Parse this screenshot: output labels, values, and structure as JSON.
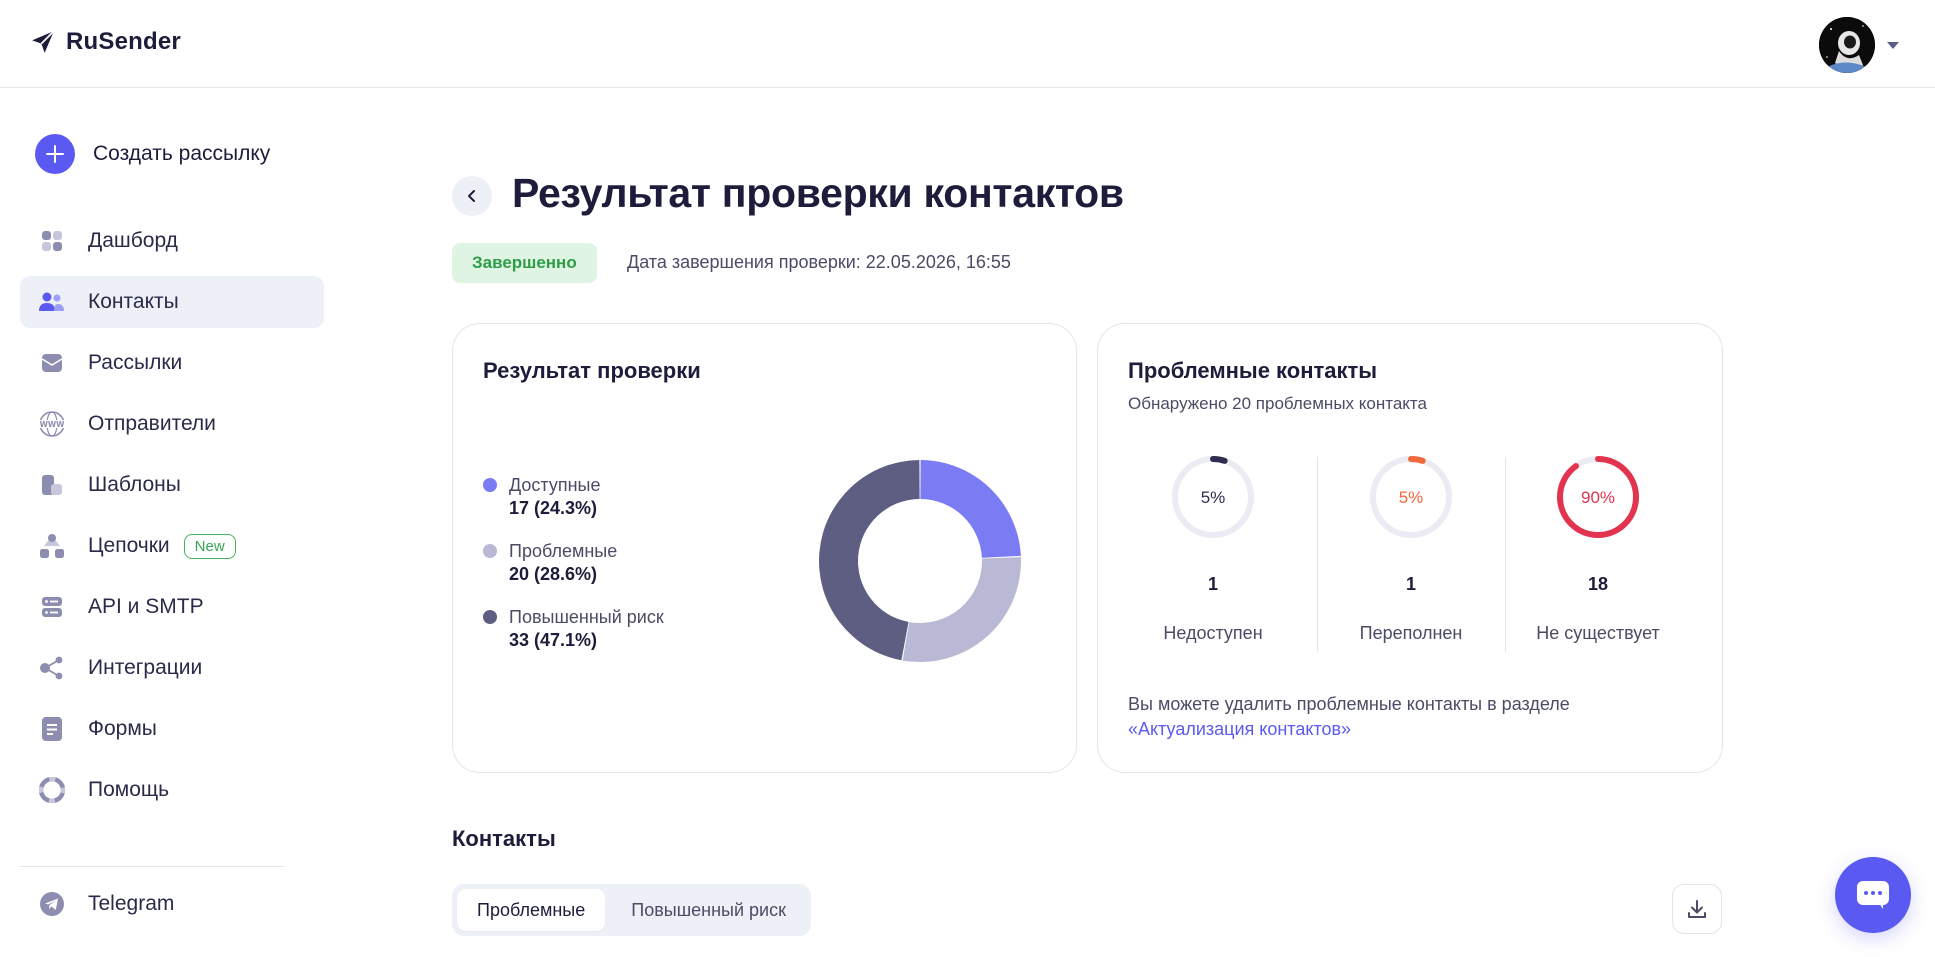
{
  "app": {
    "name": "RuSender"
  },
  "sidebar": {
    "create_label": "Создать рассылку",
    "items": [
      {
        "label": "Дашборд",
        "icon": "dashboard-icon"
      },
      {
        "label": "Контакты",
        "icon": "contacts-icon",
        "active": true
      },
      {
        "label": "Рассылки",
        "icon": "mailings-icon"
      },
      {
        "label": "Отправители",
        "icon": "www-icon"
      },
      {
        "label": "Шаблоны",
        "icon": "templates-icon"
      },
      {
        "label": "Цепочки",
        "icon": "chains-icon",
        "badge": "New"
      },
      {
        "label": "API и SMTP",
        "icon": "server-icon"
      },
      {
        "label": "Интеграции",
        "icon": "integrations-icon"
      },
      {
        "label": "Формы",
        "icon": "forms-icon"
      },
      {
        "label": "Помощь",
        "icon": "help-icon"
      }
    ],
    "telegram_label": "Telegram"
  },
  "page": {
    "title": "Результат проверки контактов",
    "status": "Завершенно",
    "completion_date": "Дата завершения проверки: 22.05.2026, 16:55"
  },
  "result_card": {
    "title": "Результат проверки",
    "legend": [
      {
        "name": "Доступные",
        "value": "17 (24.3%)",
        "color": "#7b7cf4"
      },
      {
        "name": "Проблемные",
        "value": "20 (28.6%)",
        "color": "#b9b9d6"
      },
      {
        "name": "Повышенный риск",
        "value": "33 (47.1%)",
        "color": "#5e5e82"
      }
    ]
  },
  "chart_data": {
    "type": "pie",
    "categories": [
      "Доступные",
      "Проблемные",
      "Повышенный риск"
    ],
    "values": [
      17,
      20,
      33
    ],
    "colors": [
      "#7b7cf4",
      "#b9b9d6",
      "#5e5e82"
    ]
  },
  "problem_card": {
    "title": "Проблемные контакты",
    "subtitle": "Обнаружено 20 проблемных контакта",
    "metrics": [
      {
        "percent_label": "5%",
        "fraction": 0.05,
        "count": "1",
        "label": "Недоступен",
        "color": "#2d2d4f"
      },
      {
        "percent_label": "5%",
        "fraction": 0.05,
        "count": "1",
        "label": "Переполнен",
        "color": "#f2683a"
      },
      {
        "percent_label": "90%",
        "fraction": 0.9,
        "count": "18",
        "label": "Не существует",
        "color": "#e3344f"
      }
    ],
    "note": "Вы можете удалить проблемные контакты в разделе",
    "note_link": "«Актуализация контактов»"
  },
  "contacts_section": {
    "title": "Контакты",
    "tabs": [
      {
        "label": "Проблемные",
        "active": true
      },
      {
        "label": "Повышенный риск",
        "active": false
      }
    ]
  },
  "colors": {
    "accent": "#5a5af3",
    "success_bg": "#dff4e3",
    "success_text": "#2d9e47"
  }
}
